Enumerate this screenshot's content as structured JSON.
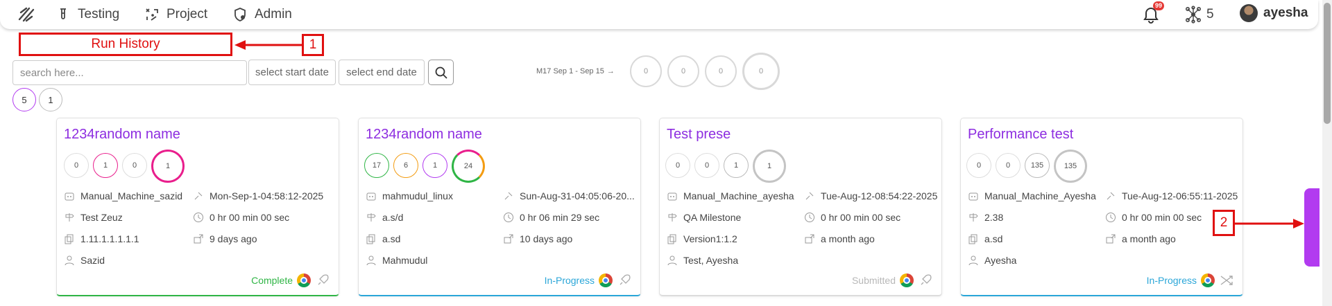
{
  "nav": {
    "testing": "Testing",
    "project": "Project",
    "admin": "Admin",
    "notifications": "99",
    "hub_count": "5",
    "username": "ayesha"
  },
  "annotations": {
    "title": "Run History",
    "marker1": "1",
    "marker2": "2"
  },
  "filters": {
    "search_placeholder": "search here...",
    "start_date": "select start date",
    "end_date": "select end date"
  },
  "milestone": {
    "label": "M17 Sep 1 - Sep 15",
    "counts": [
      "0",
      "0",
      "0",
      "0"
    ]
  },
  "pager": [
    "5",
    "1"
  ],
  "colors": {
    "accent": "#8d2de0",
    "complete": "#2fb545",
    "in_progress": "#2aa6d8",
    "submitted": "#b8b8b8",
    "annotation": "#e01010"
  },
  "cards": [
    {
      "title": "1234random name",
      "counts": [
        "0",
        "1",
        "0",
        "1"
      ],
      "machine": "Manual_Machine_sazid",
      "date": "Mon-Sep-1-04:58:12-2025",
      "milestone": "Test Zeuz",
      "duration": "0 hr 00 min 00 sec",
      "version": "1.11.1.1.1.1.1",
      "ago": "9 days ago",
      "assignee": "Sazid",
      "status": "Complete"
    },
    {
      "title": "1234random name",
      "counts": [
        "17",
        "6",
        "1",
        "24"
      ],
      "machine": "mahmudul_linux",
      "date": "Sun-Aug-31-04:05:06-20...",
      "milestone": "a.s/d",
      "duration": "0 hr 06 min 29 sec",
      "version": "a.sd",
      "ago": "10 days ago",
      "assignee": "Mahmudul",
      "status": "In-Progress"
    },
    {
      "title": "Test prese",
      "counts": [
        "0",
        "0",
        "1",
        "1"
      ],
      "machine": "Manual_Machine_ayesha",
      "date": "Tue-Aug-12-08:54:22-2025",
      "milestone": "QA Milestone",
      "duration": "0 hr 00 min 00 sec",
      "version": "Version1:1.2",
      "ago": "a month ago",
      "assignee": "Test, Ayesha",
      "status": "Submitted"
    },
    {
      "title": "Performance test",
      "counts": [
        "0",
        "0",
        "135",
        "135"
      ],
      "machine": "Manual_Machine_Ayesha",
      "date": "Tue-Aug-12-06:55:11-2025",
      "milestone": "2.38",
      "duration": "0 hr 00 min 00 sec",
      "version": "a.sd",
      "ago": "a month ago",
      "assignee": "Ayesha",
      "status": "In-Progress"
    }
  ]
}
